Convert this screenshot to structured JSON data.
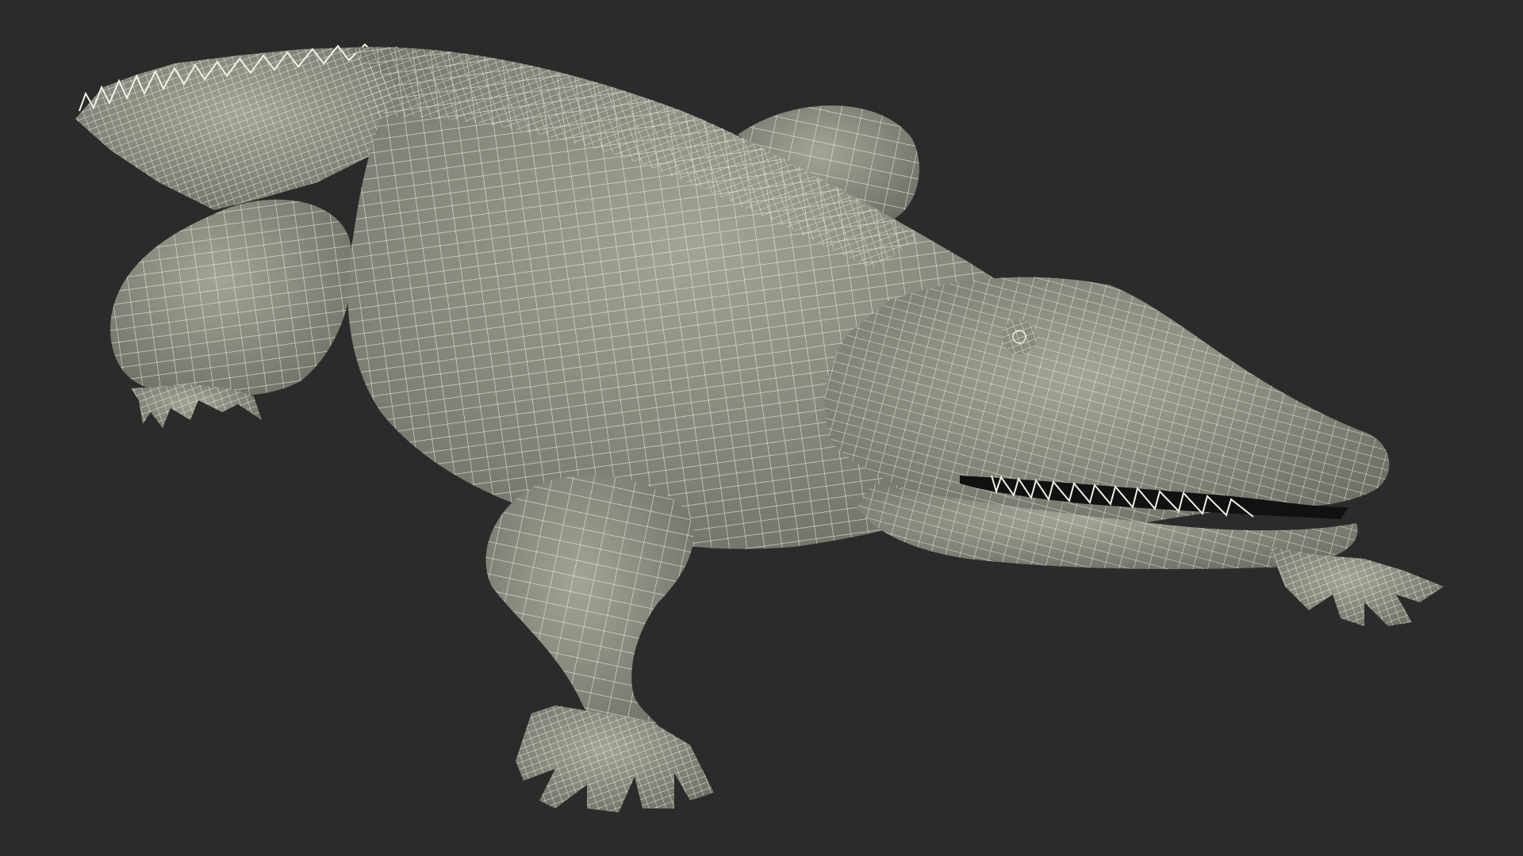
{
  "scene": {
    "background_color": "#2b2b2b",
    "mesh_fill_color": "#8f8f83",
    "mesh_shadow_color": "#6f6f66",
    "wire_color": "#f2f1e6",
    "mouth_color": "#111111",
    "subject_icon": "crocodile-wireframe-model"
  }
}
